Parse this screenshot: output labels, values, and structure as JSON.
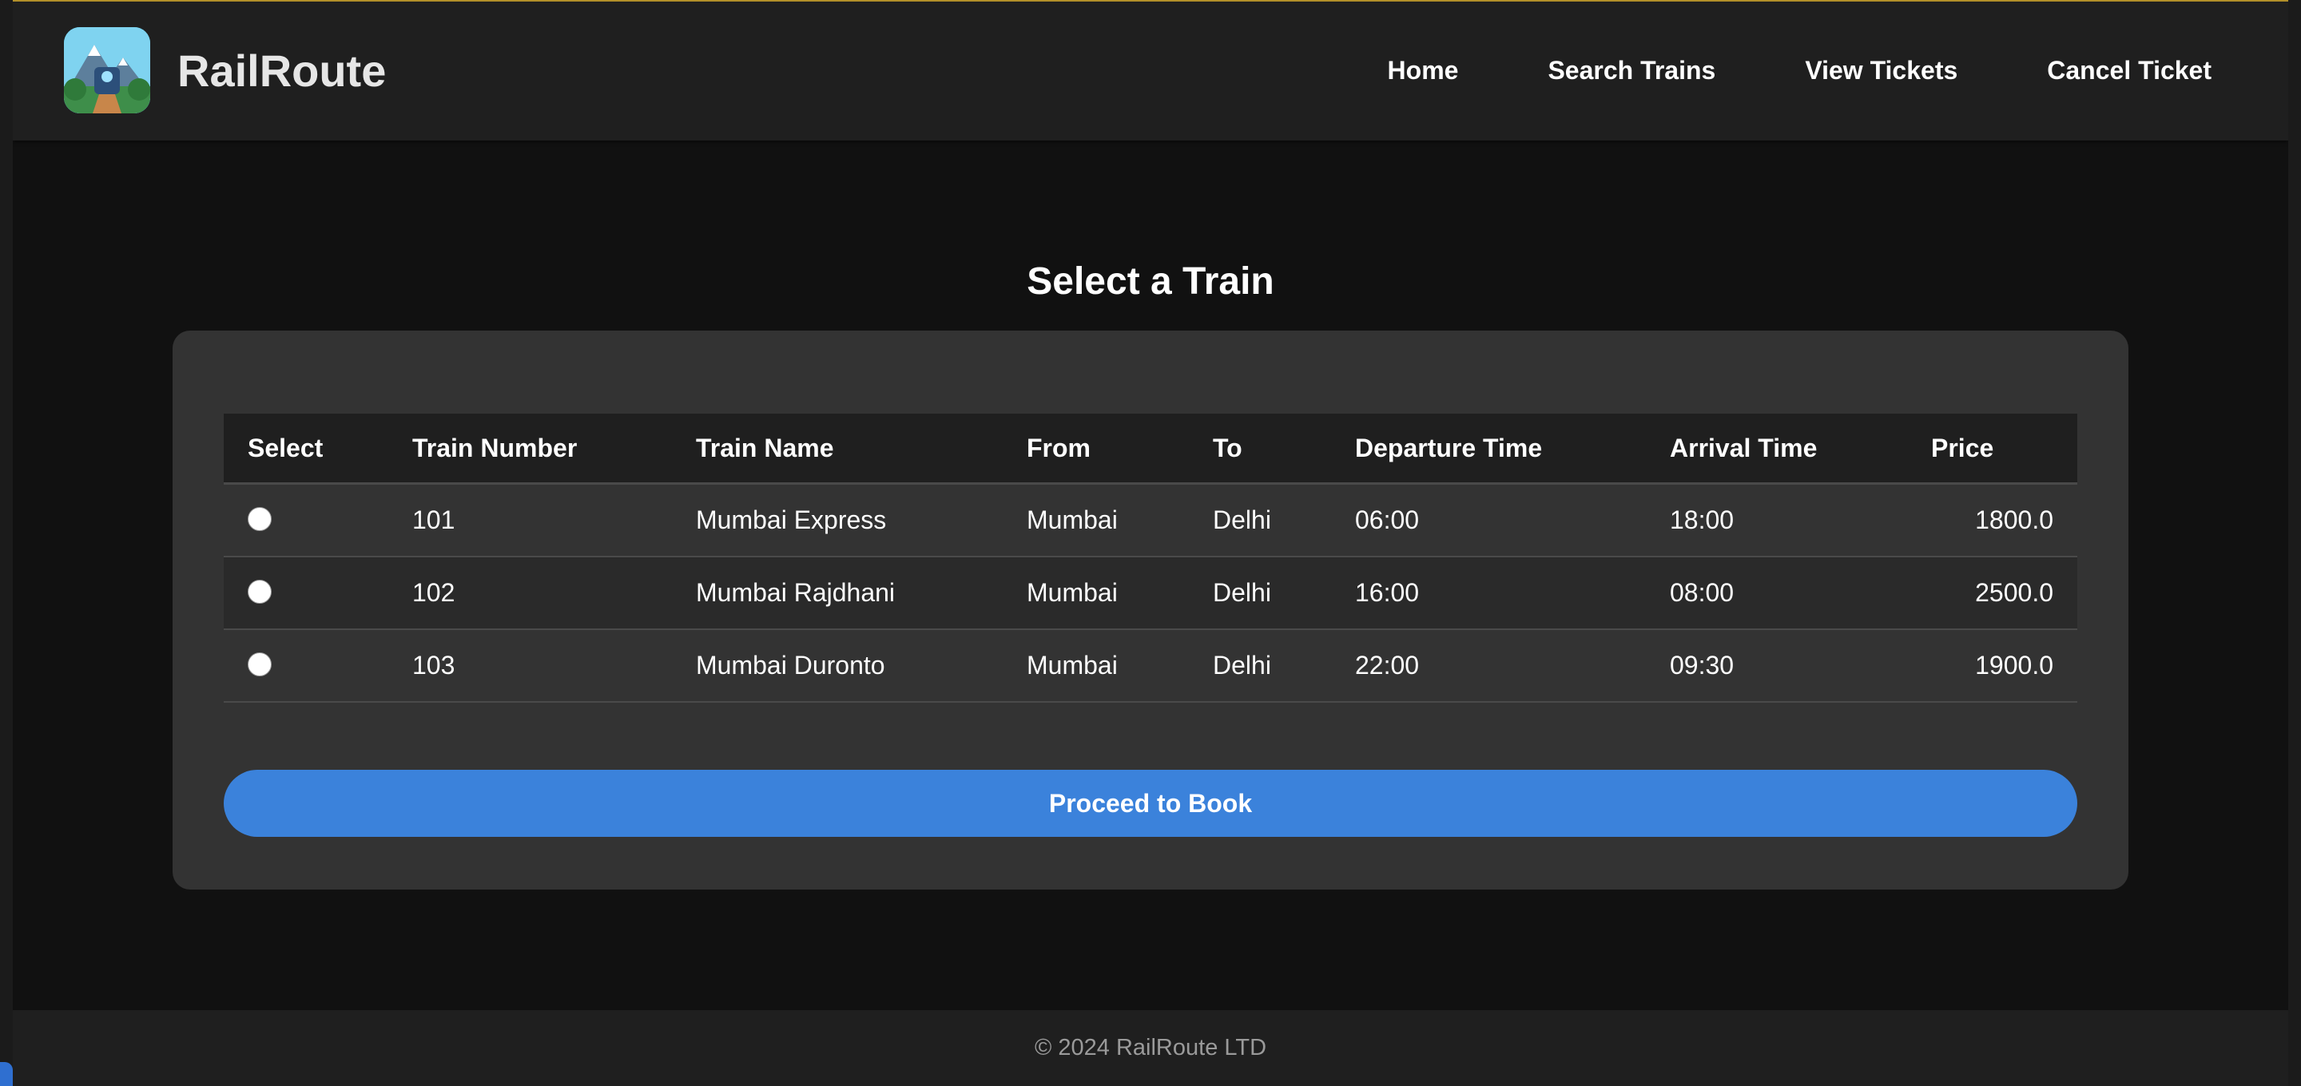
{
  "header": {
    "brand": "RailRoute",
    "nav": [
      "Home",
      "Search Trains",
      "View Tickets",
      "Cancel Ticket"
    ]
  },
  "main": {
    "title": "Select a Train",
    "table": {
      "headers": [
        "Select",
        "Train Number",
        "Train Name",
        "From",
        "To",
        "Departure Time",
        "Arrival Time",
        "Price"
      ],
      "rows": [
        {
          "number": "101",
          "name": "Mumbai Express",
          "from": "Mumbai",
          "to": "Delhi",
          "departure": "06:00",
          "arrival": "18:00",
          "price": "1800.0",
          "selected": false
        },
        {
          "number": "102",
          "name": "Mumbai Rajdhani",
          "from": "Mumbai",
          "to": "Delhi",
          "departure": "16:00",
          "arrival": "08:00",
          "price": "2500.0",
          "selected": false
        },
        {
          "number": "103",
          "name": "Mumbai Duronto",
          "from": "Mumbai",
          "to": "Delhi",
          "departure": "22:00",
          "arrival": "09:30",
          "price": "1900.0",
          "selected": false
        }
      ]
    },
    "proceed_label": "Proceed to Book"
  },
  "footer": {
    "copyright": "© 2024 RailRoute LTD"
  },
  "colors": {
    "accent": "#3b82db",
    "header_bg": "#1f1f1f",
    "page_bg": "#111111",
    "card_bg": "#333333",
    "top_border": "#b8952c"
  },
  "icons": {
    "logo": "train-logo-icon"
  }
}
